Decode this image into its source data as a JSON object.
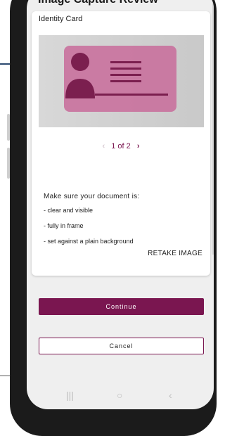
{
  "app": {
    "title": "Image Capture Review"
  },
  "card": {
    "title": "Identity Card",
    "image_alt": "Identity card preview illustration",
    "pager": {
      "text": "1 of 2"
    }
  },
  "instructions": {
    "title": "Make sure your document is:",
    "items": [
      "- clear and visible",
      "- fully in frame",
      "- set against a plain background"
    ]
  },
  "actions": {
    "retake_label": "RETAKE IMAGE",
    "continue_label": "Continue",
    "cancel_label": "Cancel"
  },
  "icons": {
    "pager_prev": "chevron-left-icon",
    "pager_next": "chevron-right-icon",
    "nav_recents": "recents-icon",
    "nav_home": "home-icon",
    "nav_back": "back-icon"
  },
  "colors": {
    "accent": "#7a1650",
    "id_card": "#c9739e",
    "background": "#efefef"
  }
}
